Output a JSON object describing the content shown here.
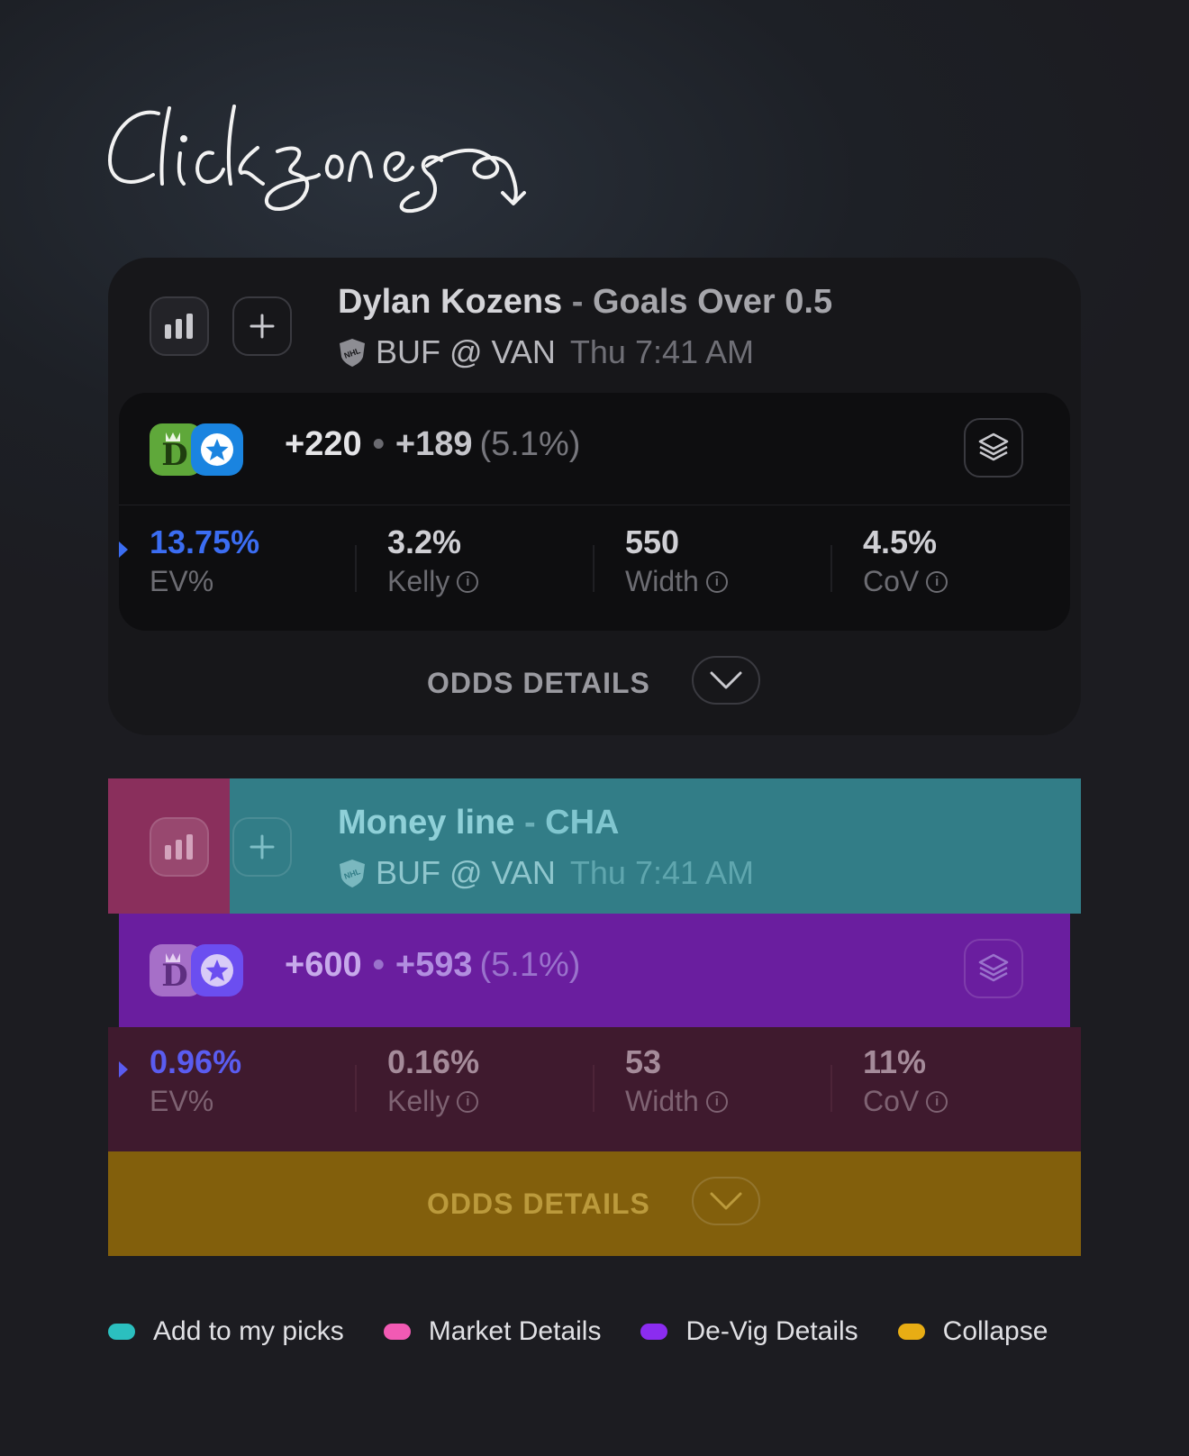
{
  "heading": "Click zones",
  "colors": {
    "add_to_picks": "#2bbfbf",
    "market_details": "#f25ab4",
    "devig_details": "#8b2cf0",
    "collapse": "#e8ad14"
  },
  "cards": [
    {
      "player": "Dylan Kozens",
      "separator": "-",
      "market": "Goals Over 0.5",
      "league_icon": "nhl-icon",
      "teams": "BUF @ VAN",
      "time": "Thu 7:41 AM",
      "books": [
        "draftkings-icon",
        "star-book-icon"
      ],
      "odds": "+220",
      "fair_odds": "+189",
      "vig": "(5.1%)",
      "stats": {
        "ev": {
          "value": "13.75%",
          "label": "EV%"
        },
        "kelly": {
          "value": "3.2%",
          "label": "Kelly"
        },
        "width": {
          "value": "550",
          "label": "Width"
        },
        "cov": {
          "value": "4.5%",
          "label": "CoV"
        }
      },
      "odds_details": "ODDS DETAILS"
    },
    {
      "player": "Money line",
      "separator": "-",
      "market": "CHA",
      "league_icon": "nhl-icon",
      "teams": "BUF @ VAN",
      "time": "Thu 7:41 AM",
      "books": [
        "draftkings-icon",
        "star-book-icon"
      ],
      "odds": "+600",
      "fair_odds": "+593",
      "vig": "(5.1%)",
      "stats": {
        "ev": {
          "value": "0.96%",
          "label": "EV%"
        },
        "kelly": {
          "value": "0.16%",
          "label": "Kelly"
        },
        "width": {
          "value": "53",
          "label": "Width"
        },
        "cov": {
          "value": "11%",
          "label": "CoV"
        }
      },
      "odds_details": "ODDS DETAILS"
    }
  ],
  "legend": [
    {
      "label": "Add to my picks",
      "color": "#2bbfbf"
    },
    {
      "label": "Market Details",
      "color": "#f25ab4"
    },
    {
      "label": "De-Vig Details",
      "color": "#8b2cf0"
    },
    {
      "label": "Collapse",
      "color": "#e8ad14"
    }
  ]
}
